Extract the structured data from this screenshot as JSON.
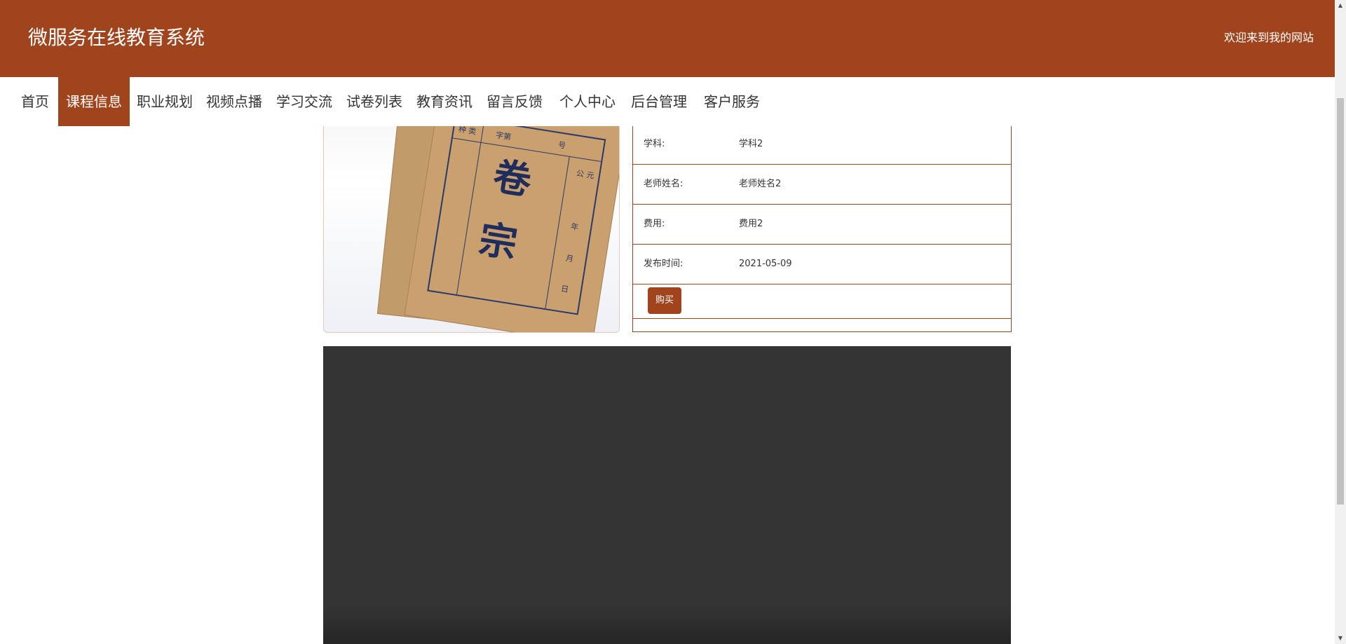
{
  "header": {
    "site_title": "微服务在线教育系统",
    "welcome": "欢迎来到我的网站"
  },
  "nav": {
    "active_index": 1,
    "items": [
      "首页",
      "课程信息",
      "职业规划",
      "视频点播",
      "学习交流",
      "试卷列表",
      "教育资讯",
      "留言反馈",
      "个人中心",
      "后台管理",
      "客户服务"
    ]
  },
  "course": {
    "image_alt_icon": "archive-folder-image",
    "image_text": {
      "char1": "卷",
      "char2": "宗",
      "field1": "种 类",
      "field2": "字第",
      "field3": "号",
      "field4": "公 元",
      "field5": "年",
      "field6": "月",
      "field7": "日"
    },
    "details": [
      {
        "label": "学科:",
        "value": "学科2"
      },
      {
        "label": "老师姓名:",
        "value": "老师姓名2"
      },
      {
        "label": "费用:",
        "value": "费用2"
      },
      {
        "label": "发布时间:",
        "value": "2021-05-09"
      }
    ],
    "buy_label": "购买"
  },
  "colors": {
    "brand": "#a0441d",
    "video_bg": "#333333"
  }
}
